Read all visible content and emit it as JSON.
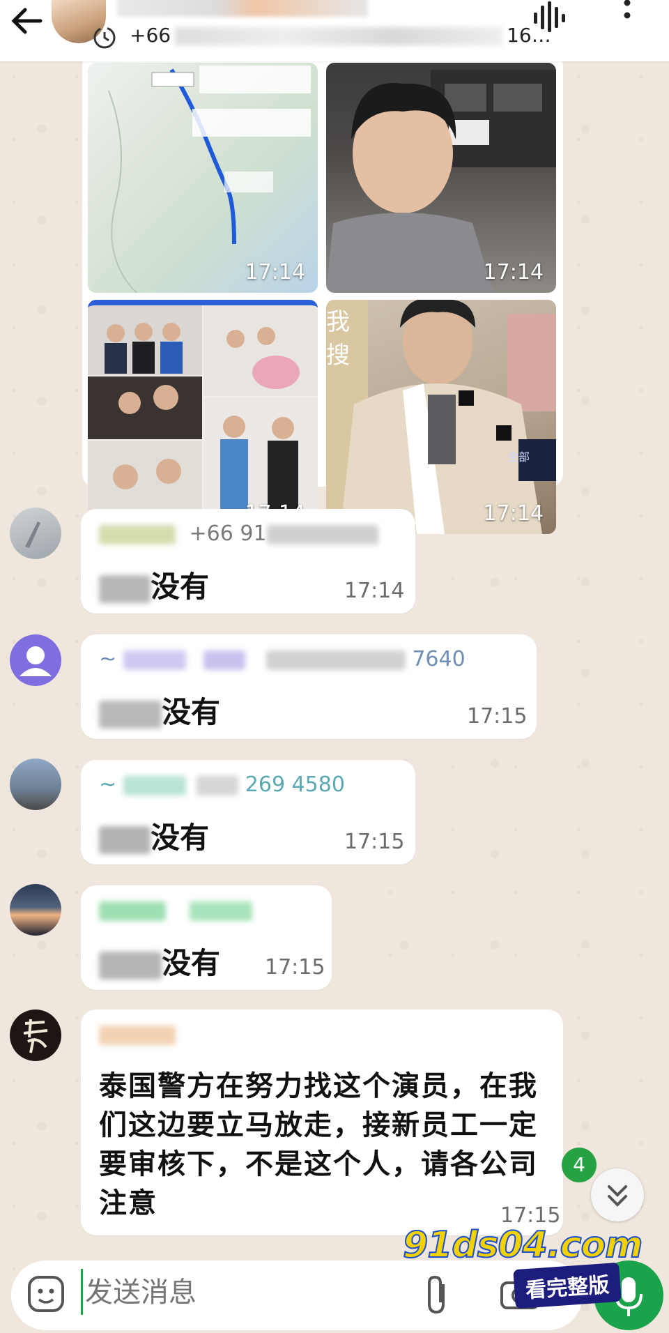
{
  "header": {
    "phone_prefix": "+66",
    "phone_suffix": "16…"
  },
  "media": {
    "timestamps": [
      "17:14",
      "17:14",
      "17:14",
      "17:14"
    ],
    "overlay_char_1": "我",
    "overlay_char_2": "搜",
    "tile4_label": "全部"
  },
  "messages": [
    {
      "sender_suffix": "+66 91",
      "text_suffix": "没有",
      "time": "17:14"
    },
    {
      "sender_prefix": "~",
      "sender_suffix": "7640",
      "text_suffix": "没有",
      "time": "17:15"
    },
    {
      "sender_prefix": "~",
      "sender_suffix": "269 4580",
      "text_suffix": "没有",
      "time": "17:15"
    },
    {
      "text_suffix": "没有",
      "time": "17:15"
    },
    {
      "text": "泰国警方在努力找这个演员，在我们这边要立马放走，接新员工一定要审核下，不是这个人，请各公司注意",
      "time": "17:15"
    }
  ],
  "unread_badge": "4",
  "composer": {
    "placeholder": "发送消息"
  },
  "watermark": {
    "site": "91ds04.com",
    "button": "看完整版"
  }
}
